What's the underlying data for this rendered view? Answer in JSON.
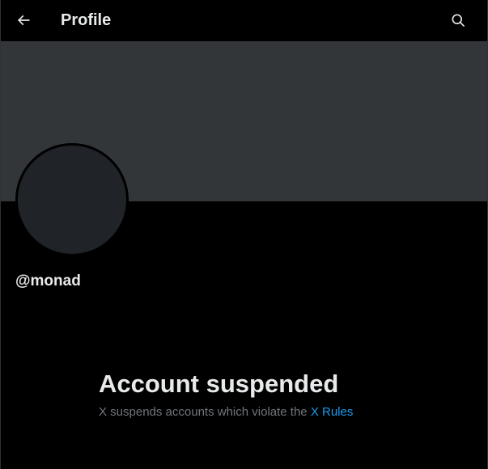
{
  "header": {
    "title": "Profile",
    "back_icon": "arrow-left-icon",
    "search_icon": "search-icon"
  },
  "profile": {
    "handle": "@monad"
  },
  "suspended": {
    "title": "Account suspended",
    "message": "X suspends accounts which violate the",
    "link_label": "X Rules"
  },
  "colors": {
    "background": "#000000",
    "banner": "#333639",
    "avatar": "#202327",
    "primary_text": "#e7e9ea",
    "secondary_text": "#71767b",
    "link": "#1d9bf0"
  }
}
